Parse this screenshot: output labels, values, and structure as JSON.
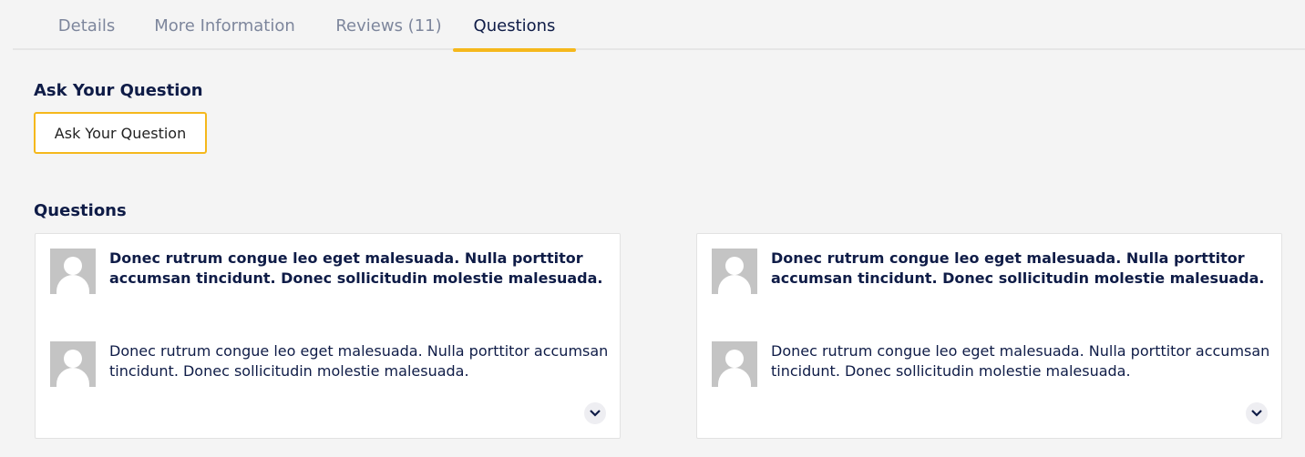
{
  "tabs": [
    {
      "label": "Details",
      "active": false
    },
    {
      "label": "More Information",
      "active": false
    },
    {
      "label": "Reviews (11)",
      "active": false
    },
    {
      "label": "Questions",
      "active": true
    }
  ],
  "ask_section": {
    "title": "Ask Your Question",
    "button_label": "Ask Your Question"
  },
  "questions_section": {
    "title": "Questions",
    "items": [
      {
        "question": "Donec rutrum congue leo eget malesuada. Nulla porttitor accumsan tincidunt. Donec sollicitudin molestie malesuada.",
        "answer": "Donec rutrum congue leo eget malesuada. Nulla porttitor accumsan tincidunt. Donec sollicitudin molestie malesuada."
      },
      {
        "question": "Donec rutrum congue leo eget malesuada. Nulla porttitor accumsan tincidunt. Donec sollicitudin molestie malesuada.",
        "answer": "Donec rutrum congue leo eget malesuada. Nulla porttitor accumsan tincidunt. Donec sollicitudin molestie malesuada."
      }
    ]
  },
  "colors": {
    "accent": "#f5b81c",
    "text_dark": "#0f1c47",
    "tab_inactive": "#7d869c",
    "background": "#f4f4f4"
  }
}
